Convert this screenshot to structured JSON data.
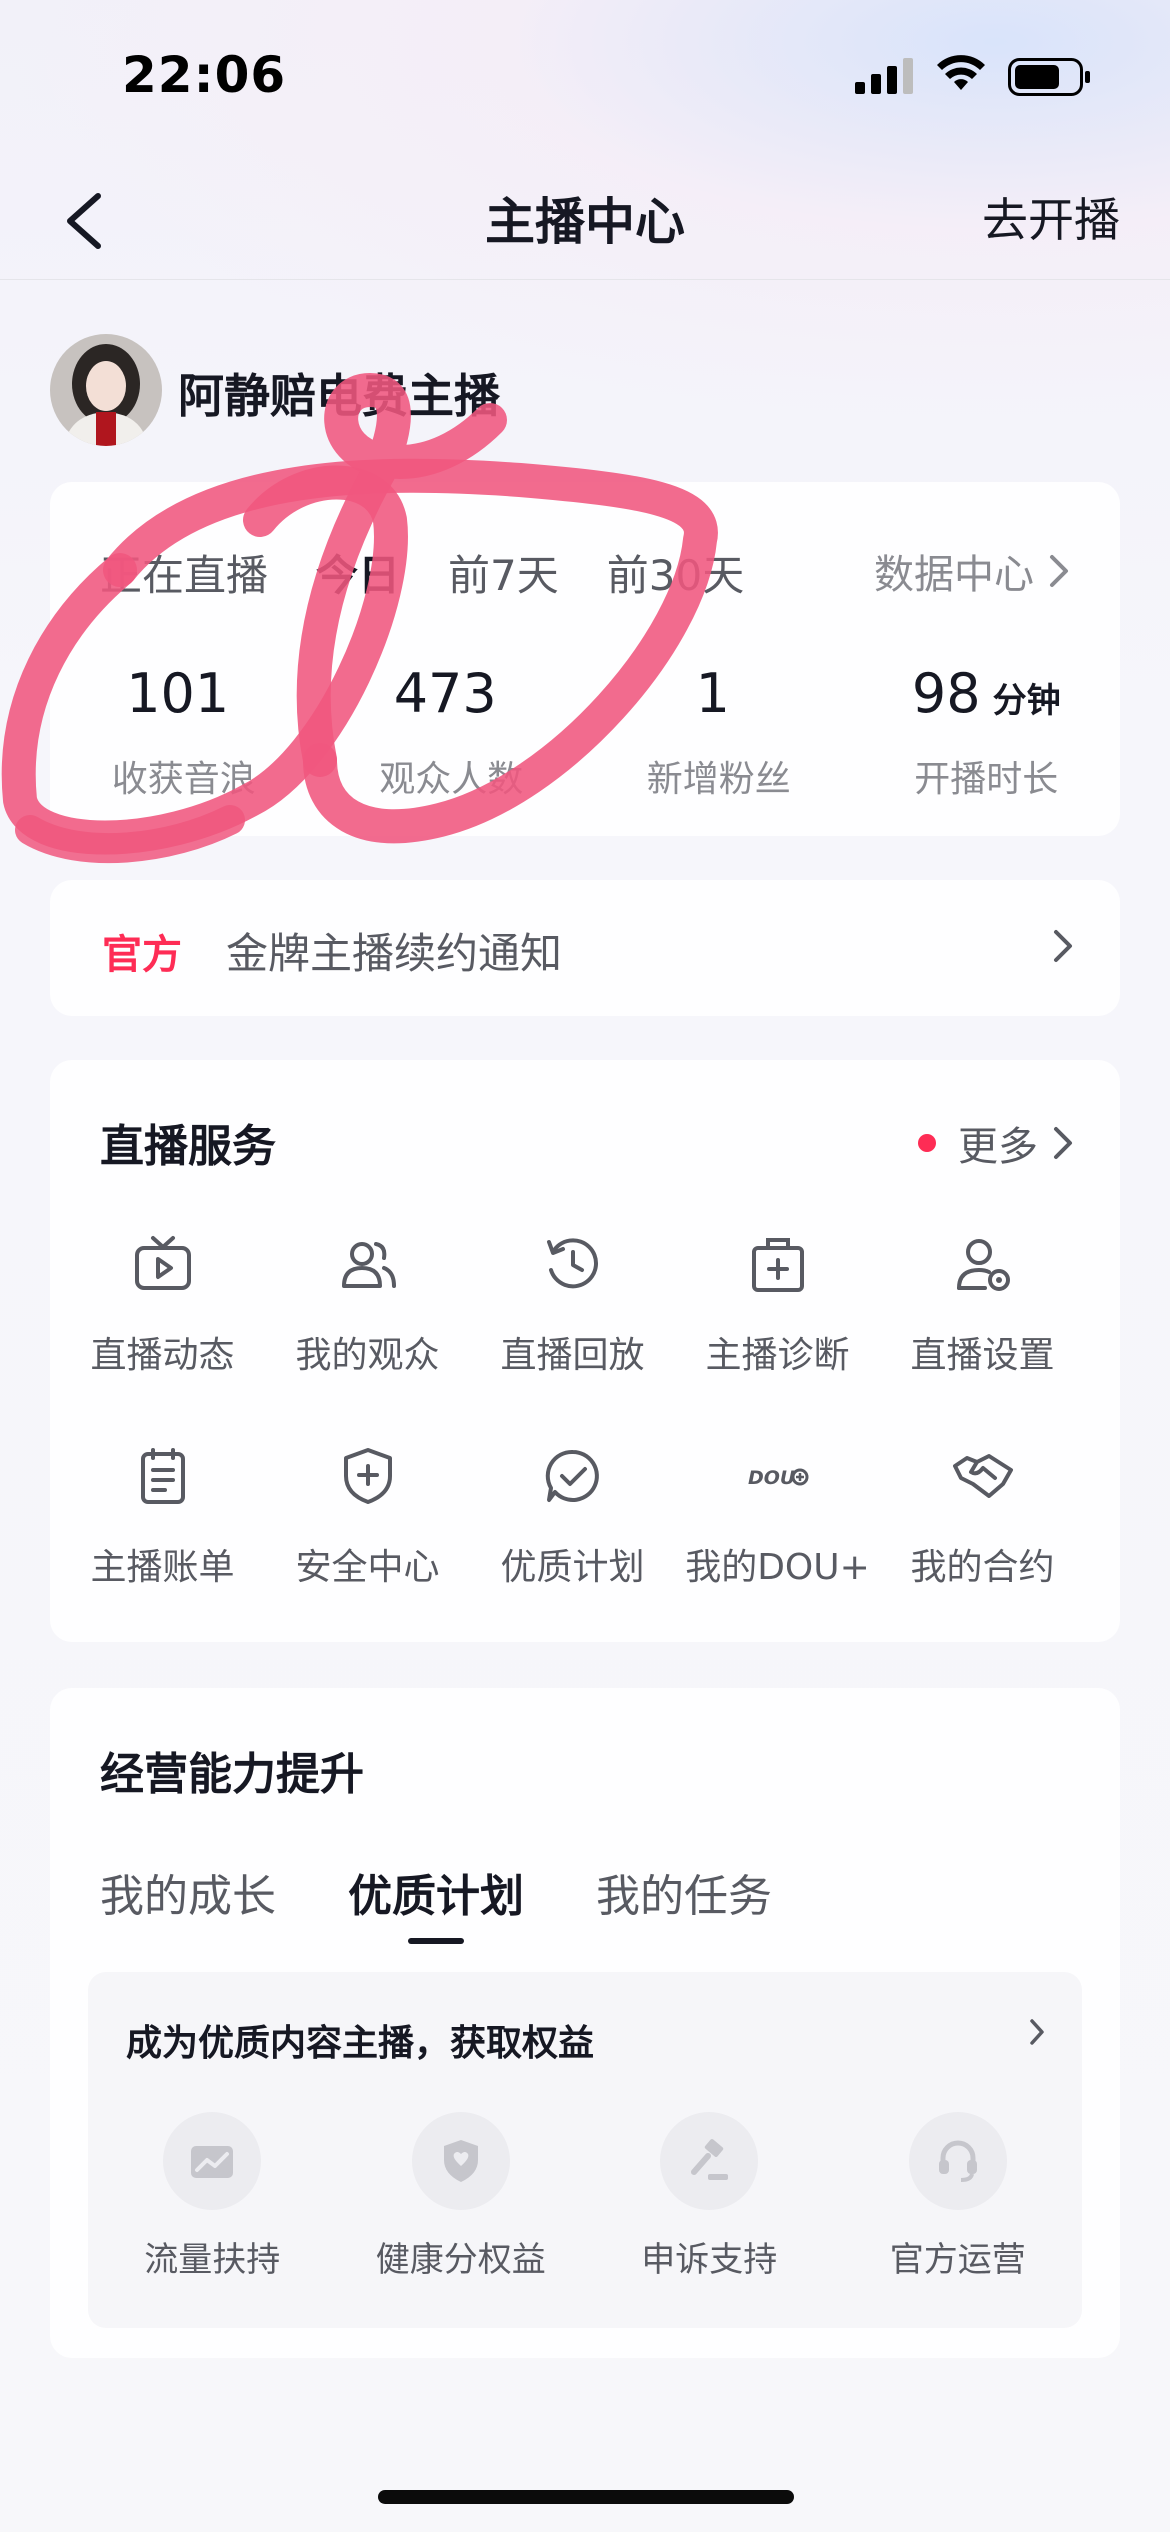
{
  "status_bar": {
    "time": "22:06"
  },
  "nav": {
    "title": "主播中心",
    "go_live": "去开播"
  },
  "profile": {
    "name": "阿静赔电费主播"
  },
  "stats": {
    "tabs": [
      "正在直播",
      "今日",
      "前7天",
      "前30天"
    ],
    "active_tab": "今日",
    "data_center": "数据中心",
    "items": [
      {
        "value": "101",
        "unit": "",
        "label": "收获音浪"
      },
      {
        "value": "473",
        "unit": "",
        "label": "观众人数"
      },
      {
        "value": "1",
        "unit": "",
        "label": "新增粉丝"
      },
      {
        "value": "98",
        "unit": "分钟",
        "label": "开播时长"
      }
    ]
  },
  "notice": {
    "tag": "官方",
    "text": "金牌主播续约通知"
  },
  "services": {
    "title": "直播服务",
    "more": "更多",
    "items": [
      {
        "label": "直播动态",
        "icon": "tv-play-icon"
      },
      {
        "label": "我的观众",
        "icon": "audience-icon"
      },
      {
        "label": "直播回放",
        "icon": "replay-clock-icon"
      },
      {
        "label": "主播诊断",
        "icon": "medical-kit-icon"
      },
      {
        "label": "直播设置",
        "icon": "user-settings-icon"
      },
      {
        "label": "主播账单",
        "icon": "bill-icon"
      },
      {
        "label": "安全中心",
        "icon": "shield-plus-icon"
      },
      {
        "label": "优质计划",
        "icon": "check-chat-icon"
      },
      {
        "label": "我的DOU+",
        "icon": "dou-plus-icon"
      },
      {
        "label": "我的合约",
        "icon": "handshake-icon"
      }
    ]
  },
  "growth": {
    "title": "经营能力提升",
    "tabs": [
      "我的成长",
      "优质计划",
      "我的任务"
    ],
    "active_tab": "优质计划",
    "panel_title": "成为优质内容主播，获取权益",
    "benefits": [
      {
        "label": "流量扶持",
        "icon": "traffic-chart-icon"
      },
      {
        "label": "健康分权益",
        "icon": "health-shield-icon"
      },
      {
        "label": "申诉支持",
        "icon": "gavel-icon"
      },
      {
        "label": "官方运营",
        "icon": "headset-icon"
      }
    ]
  },
  "dou_icon_text": "DOU",
  "colors": {
    "accent": "#fe2c55",
    "scribble": "#f0577e",
    "text": "#161823"
  }
}
